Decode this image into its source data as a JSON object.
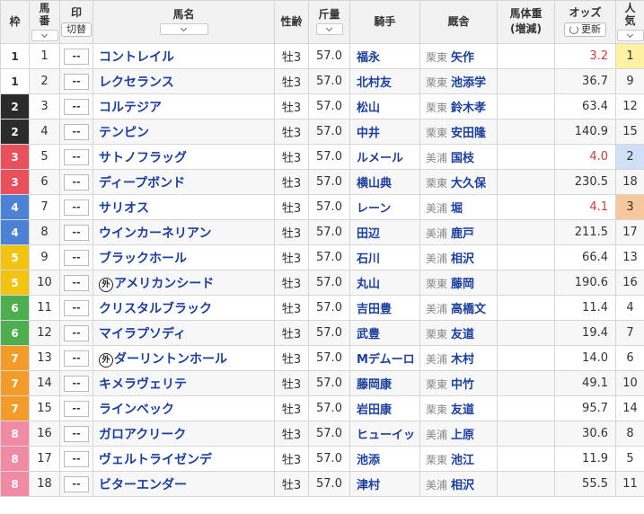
{
  "colors": {
    "waku": {
      "1": {
        "bg": "#ffffff",
        "fg": "#333333"
      },
      "2": {
        "bg": "#2b2b2b",
        "fg": "#ffffff"
      },
      "3": {
        "bg": "#e8505b",
        "fg": "#ffffff"
      },
      "4": {
        "bg": "#4b82d6",
        "fg": "#ffffff"
      },
      "5": {
        "bg": "#f2c40f",
        "fg": "#ffffff"
      },
      "6": {
        "bg": "#4cae4c",
        "fg": "#ffffff"
      },
      "7": {
        "bg": "#f39c2a",
        "fg": "#ffffff"
      },
      "8": {
        "bg": "#f08aa5",
        "fg": "#ffffff"
      }
    },
    "pop_highlight": {
      "1": "#fdf2a3",
      "2": "#cfe0f7",
      "3": "#f6c89c"
    }
  },
  "header": {
    "waku": "枠",
    "umaban": [
      "馬",
      "番"
    ],
    "mark": "印",
    "mark_toggle": "切替",
    "name": "馬名",
    "sexage": "性齢",
    "weight": "斤量",
    "jockey": "騎手",
    "trainer": "厩舎",
    "body_weight": "馬体重",
    "body_weight_sub": "(増減)",
    "odds": "オッズ",
    "refresh": "更新",
    "popularity": [
      "人",
      "気"
    ]
  },
  "rows": [
    {
      "waku": "1",
      "num": "1",
      "mark": "--",
      "name": "コントレイル",
      "foreign": false,
      "sexage": "牡3",
      "weight": "57.0",
      "jockey": "福永",
      "area": "栗東",
      "trainer": "矢作",
      "odds": "3.2",
      "pop": "1"
    },
    {
      "waku": "1",
      "num": "2",
      "mark": "--",
      "name": "レクセランス",
      "foreign": false,
      "sexage": "牡3",
      "weight": "57.0",
      "jockey": "北村友",
      "area": "栗東",
      "trainer": "池添学",
      "odds": "36.7",
      "pop": "9"
    },
    {
      "waku": "2",
      "num": "3",
      "mark": "--",
      "name": "コルテジア",
      "foreign": false,
      "sexage": "牡3",
      "weight": "57.0",
      "jockey": "松山",
      "area": "栗東",
      "trainer": "鈴木孝",
      "odds": "63.4",
      "pop": "12"
    },
    {
      "waku": "2",
      "num": "4",
      "mark": "--",
      "name": "テンピン",
      "foreign": false,
      "sexage": "牡3",
      "weight": "57.0",
      "jockey": "中井",
      "area": "栗東",
      "trainer": "安田隆",
      "odds": "140.9",
      "pop": "15"
    },
    {
      "waku": "3",
      "num": "5",
      "mark": "--",
      "name": "サトノフラッグ",
      "foreign": false,
      "sexage": "牡3",
      "weight": "57.0",
      "jockey": "ルメール",
      "area": "美浦",
      "trainer": "国枝",
      "odds": "4.0",
      "pop": "2"
    },
    {
      "waku": "3",
      "num": "6",
      "mark": "--",
      "name": "ディープボンド",
      "foreign": false,
      "sexage": "牡3",
      "weight": "57.0",
      "jockey": "横山典",
      "area": "栗東",
      "trainer": "大久保",
      "odds": "230.5",
      "pop": "18"
    },
    {
      "waku": "4",
      "num": "7",
      "mark": "--",
      "name": "サリオス",
      "foreign": false,
      "sexage": "牡3",
      "weight": "57.0",
      "jockey": "レーン",
      "area": "美浦",
      "trainer": "堀",
      "odds": "4.1",
      "pop": "3"
    },
    {
      "waku": "4",
      "num": "8",
      "mark": "--",
      "name": "ウインカーネリアン",
      "foreign": false,
      "sexage": "牡3",
      "weight": "57.0",
      "jockey": "田辺",
      "area": "美浦",
      "trainer": "鹿戸",
      "odds": "211.5",
      "pop": "17"
    },
    {
      "waku": "5",
      "num": "9",
      "mark": "--",
      "name": "ブラックホール",
      "foreign": false,
      "sexage": "牡3",
      "weight": "57.0",
      "jockey": "石川",
      "area": "美浦",
      "trainer": "相沢",
      "odds": "66.4",
      "pop": "13"
    },
    {
      "waku": "5",
      "num": "10",
      "mark": "--",
      "name": "アメリカンシード",
      "foreign": true,
      "sexage": "牡3",
      "weight": "57.0",
      "jockey": "丸山",
      "area": "栗東",
      "trainer": "藤岡",
      "odds": "190.6",
      "pop": "16"
    },
    {
      "waku": "6",
      "num": "11",
      "mark": "--",
      "name": "クリスタルブラック",
      "foreign": false,
      "sexage": "牡3",
      "weight": "57.0",
      "jockey": "吉田豊",
      "area": "美浦",
      "trainer": "高橋文",
      "odds": "11.4",
      "pop": "4"
    },
    {
      "waku": "6",
      "num": "12",
      "mark": "--",
      "name": "マイラプソディ",
      "foreign": false,
      "sexage": "牡3",
      "weight": "57.0",
      "jockey": "武豊",
      "area": "栗東",
      "trainer": "友道",
      "odds": "19.4",
      "pop": "7"
    },
    {
      "waku": "7",
      "num": "13",
      "mark": "--",
      "name": "ダーリントンホール",
      "foreign": true,
      "sexage": "牡3",
      "weight": "57.0",
      "jockey": "Mデムーロ",
      "area": "美浦",
      "trainer": "木村",
      "odds": "14.0",
      "pop": "6"
    },
    {
      "waku": "7",
      "num": "14",
      "mark": "--",
      "name": "キメラヴェリテ",
      "foreign": false,
      "sexage": "牡3",
      "weight": "57.0",
      "jockey": "藤岡康",
      "area": "栗東",
      "trainer": "中竹",
      "odds": "49.1",
      "pop": "10"
    },
    {
      "waku": "7",
      "num": "15",
      "mark": "--",
      "name": "ラインベック",
      "foreign": false,
      "sexage": "牡3",
      "weight": "57.0",
      "jockey": "岩田康",
      "area": "栗東",
      "trainer": "友道",
      "odds": "95.7",
      "pop": "14"
    },
    {
      "waku": "8",
      "num": "16",
      "mark": "--",
      "name": "ガロアクリーク",
      "foreign": false,
      "sexage": "牡3",
      "weight": "57.0",
      "jockey": "ヒューイッ",
      "area": "美浦",
      "trainer": "上原",
      "odds": "30.6",
      "pop": "8"
    },
    {
      "waku": "8",
      "num": "17",
      "mark": "--",
      "name": "ヴェルトライゼンデ",
      "foreign": false,
      "sexage": "牡3",
      "weight": "57.0",
      "jockey": "池添",
      "area": "栗東",
      "trainer": "池江",
      "odds": "11.9",
      "pop": "5"
    },
    {
      "waku": "8",
      "num": "18",
      "mark": "--",
      "name": "ビターエンダー",
      "foreign": false,
      "sexage": "牡3",
      "weight": "57.0",
      "jockey": "津村",
      "area": "美浦",
      "trainer": "相沢",
      "odds": "55.5",
      "pop": "11"
    }
  ],
  "foreign_mark": "外"
}
